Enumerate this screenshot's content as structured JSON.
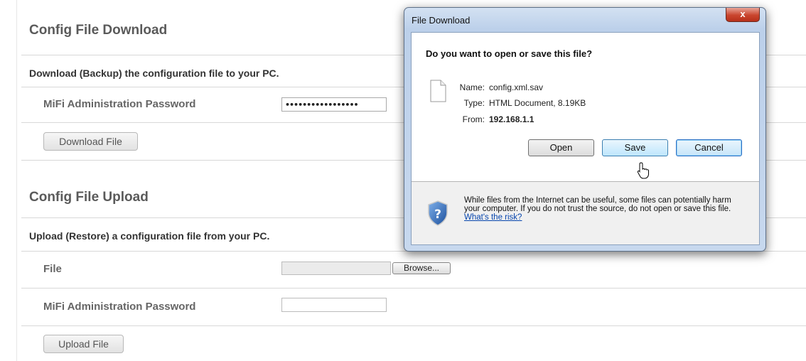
{
  "download_section": {
    "title": "Config File Download",
    "description": "Download (Backup) the configuration file to your PC.",
    "password_label": "MiFi Administration Password",
    "password_value": "•••••••••••••••••",
    "button_label": "Download File"
  },
  "upload_section": {
    "title": "Config File Upload",
    "description": "Upload (Restore) a configuration file from your PC.",
    "file_label": "File",
    "browse_label": "Browse...",
    "password_label": "MiFi Administration Password",
    "button_label": "Upload File"
  },
  "dialog": {
    "title": "File Download",
    "close_label": "x",
    "question": "Do you want to open or save this file?",
    "name_key": "Name:",
    "name_value": "config.xml.sav",
    "type_key": "Type:",
    "type_value": "HTML Document, 8.19KB",
    "from_key": "From:",
    "from_value": "192.168.1.1",
    "open_label": "Open",
    "save_label": "Save",
    "cancel_label": "Cancel",
    "warning_text": "While files from the Internet can be useful, some files can potentially harm your computer. If you do not trust the source, do not open or save this file.",
    "risk_link": "What's the risk?"
  },
  "icons": [
    "document-icon",
    "shield-question-icon",
    "mouse-cursor-icon",
    "close-icon"
  ],
  "colors": {
    "close_red": "#c9452e",
    "link_blue": "#0645ad",
    "dialog_frame": "#bcd0ea"
  }
}
